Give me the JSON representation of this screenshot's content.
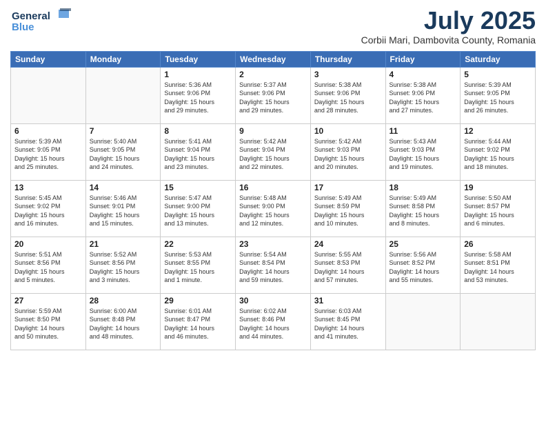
{
  "header": {
    "logo_line1": "General",
    "logo_line2": "Blue",
    "month_year": "July 2025",
    "location": "Corbii Mari, Dambovita County, Romania"
  },
  "weekdays": [
    "Sunday",
    "Monday",
    "Tuesday",
    "Wednesday",
    "Thursday",
    "Friday",
    "Saturday"
  ],
  "weeks": [
    [
      {
        "day": "",
        "info": ""
      },
      {
        "day": "",
        "info": ""
      },
      {
        "day": "1",
        "info": "Sunrise: 5:36 AM\nSunset: 9:06 PM\nDaylight: 15 hours\nand 29 minutes."
      },
      {
        "day": "2",
        "info": "Sunrise: 5:37 AM\nSunset: 9:06 PM\nDaylight: 15 hours\nand 29 minutes."
      },
      {
        "day": "3",
        "info": "Sunrise: 5:38 AM\nSunset: 9:06 PM\nDaylight: 15 hours\nand 28 minutes."
      },
      {
        "day": "4",
        "info": "Sunrise: 5:38 AM\nSunset: 9:06 PM\nDaylight: 15 hours\nand 27 minutes."
      },
      {
        "day": "5",
        "info": "Sunrise: 5:39 AM\nSunset: 9:05 PM\nDaylight: 15 hours\nand 26 minutes."
      }
    ],
    [
      {
        "day": "6",
        "info": "Sunrise: 5:39 AM\nSunset: 9:05 PM\nDaylight: 15 hours\nand 25 minutes."
      },
      {
        "day": "7",
        "info": "Sunrise: 5:40 AM\nSunset: 9:05 PM\nDaylight: 15 hours\nand 24 minutes."
      },
      {
        "day": "8",
        "info": "Sunrise: 5:41 AM\nSunset: 9:04 PM\nDaylight: 15 hours\nand 23 minutes."
      },
      {
        "day": "9",
        "info": "Sunrise: 5:42 AM\nSunset: 9:04 PM\nDaylight: 15 hours\nand 22 minutes."
      },
      {
        "day": "10",
        "info": "Sunrise: 5:42 AM\nSunset: 9:03 PM\nDaylight: 15 hours\nand 20 minutes."
      },
      {
        "day": "11",
        "info": "Sunrise: 5:43 AM\nSunset: 9:03 PM\nDaylight: 15 hours\nand 19 minutes."
      },
      {
        "day": "12",
        "info": "Sunrise: 5:44 AM\nSunset: 9:02 PM\nDaylight: 15 hours\nand 18 minutes."
      }
    ],
    [
      {
        "day": "13",
        "info": "Sunrise: 5:45 AM\nSunset: 9:02 PM\nDaylight: 15 hours\nand 16 minutes."
      },
      {
        "day": "14",
        "info": "Sunrise: 5:46 AM\nSunset: 9:01 PM\nDaylight: 15 hours\nand 15 minutes."
      },
      {
        "day": "15",
        "info": "Sunrise: 5:47 AM\nSunset: 9:00 PM\nDaylight: 15 hours\nand 13 minutes."
      },
      {
        "day": "16",
        "info": "Sunrise: 5:48 AM\nSunset: 9:00 PM\nDaylight: 15 hours\nand 12 minutes."
      },
      {
        "day": "17",
        "info": "Sunrise: 5:49 AM\nSunset: 8:59 PM\nDaylight: 15 hours\nand 10 minutes."
      },
      {
        "day": "18",
        "info": "Sunrise: 5:49 AM\nSunset: 8:58 PM\nDaylight: 15 hours\nand 8 minutes."
      },
      {
        "day": "19",
        "info": "Sunrise: 5:50 AM\nSunset: 8:57 PM\nDaylight: 15 hours\nand 6 minutes."
      }
    ],
    [
      {
        "day": "20",
        "info": "Sunrise: 5:51 AM\nSunset: 8:56 PM\nDaylight: 15 hours\nand 5 minutes."
      },
      {
        "day": "21",
        "info": "Sunrise: 5:52 AM\nSunset: 8:56 PM\nDaylight: 15 hours\nand 3 minutes."
      },
      {
        "day": "22",
        "info": "Sunrise: 5:53 AM\nSunset: 8:55 PM\nDaylight: 15 hours\nand 1 minute."
      },
      {
        "day": "23",
        "info": "Sunrise: 5:54 AM\nSunset: 8:54 PM\nDaylight: 14 hours\nand 59 minutes."
      },
      {
        "day": "24",
        "info": "Sunrise: 5:55 AM\nSunset: 8:53 PM\nDaylight: 14 hours\nand 57 minutes."
      },
      {
        "day": "25",
        "info": "Sunrise: 5:56 AM\nSunset: 8:52 PM\nDaylight: 14 hours\nand 55 minutes."
      },
      {
        "day": "26",
        "info": "Sunrise: 5:58 AM\nSunset: 8:51 PM\nDaylight: 14 hours\nand 53 minutes."
      }
    ],
    [
      {
        "day": "27",
        "info": "Sunrise: 5:59 AM\nSunset: 8:50 PM\nDaylight: 14 hours\nand 50 minutes."
      },
      {
        "day": "28",
        "info": "Sunrise: 6:00 AM\nSunset: 8:48 PM\nDaylight: 14 hours\nand 48 minutes."
      },
      {
        "day": "29",
        "info": "Sunrise: 6:01 AM\nSunset: 8:47 PM\nDaylight: 14 hours\nand 46 minutes."
      },
      {
        "day": "30",
        "info": "Sunrise: 6:02 AM\nSunset: 8:46 PM\nDaylight: 14 hours\nand 44 minutes."
      },
      {
        "day": "31",
        "info": "Sunrise: 6:03 AM\nSunset: 8:45 PM\nDaylight: 14 hours\nand 41 minutes."
      },
      {
        "day": "",
        "info": ""
      },
      {
        "day": "",
        "info": ""
      }
    ]
  ]
}
